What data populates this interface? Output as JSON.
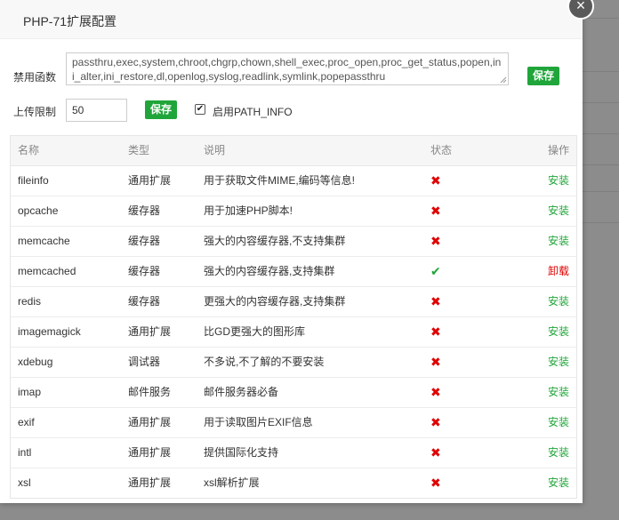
{
  "modal": {
    "title": "PHP-71扩展配置",
    "close": "×"
  },
  "disable_functions": {
    "label": "禁用函数",
    "value": "passthru,exec,system,chroot,chgrp,chown,shell_exec,proc_open,proc_get_status,popen,ini_alter,ini_restore,dl,openlog,syslog,readlink,symlink,popepassthru",
    "save_label": "保存"
  },
  "upload_limit": {
    "label": "上传限制",
    "value": "50",
    "save_label": "保存"
  },
  "path_info": {
    "checked": true,
    "label": "启用PATH_INFO"
  },
  "table": {
    "headers": {
      "name": "名称",
      "type": "类型",
      "desc": "说明",
      "status": "状态",
      "op": "操作"
    },
    "rows": [
      {
        "name": "fileinfo",
        "type": "通用扩展",
        "desc": "用于获取文件MIME,编码等信息!",
        "status": "✖",
        "op": "安装"
      },
      {
        "name": "opcache",
        "type": "缓存器",
        "desc": "用于加速PHP脚本!",
        "status": "✖",
        "op": "安装"
      },
      {
        "name": "memcache",
        "type": "缓存器",
        "desc": "强大的内容缓存器,不支持集群",
        "status": "✖",
        "op": "安装"
      },
      {
        "name": "memcached",
        "type": "缓存器",
        "desc": "强大的内容缓存器,支持集群",
        "status": "✔",
        "op": "卸载"
      },
      {
        "name": "redis",
        "type": "缓存器",
        "desc": "更强大的内容缓存器,支持集群",
        "status": "✖",
        "op": "安装"
      },
      {
        "name": "imagemagick",
        "type": "通用扩展",
        "desc": "比GD更强大的图形库",
        "status": "✖",
        "op": "安装"
      },
      {
        "name": "xdebug",
        "type": "调试器",
        "desc": "不多说,不了解的不要安装",
        "status": "✖",
        "op": "安装"
      },
      {
        "name": "imap",
        "type": "邮件服务",
        "desc": "邮件服务器必备",
        "status": "✖",
        "op": "安装"
      },
      {
        "name": "exif",
        "type": "通用扩展",
        "desc": "用于读取图片EXIF信息",
        "status": "✖",
        "op": "安装"
      },
      {
        "name": "intl",
        "type": "通用扩展",
        "desc": "提供国际化支持",
        "status": "✖",
        "op": "安装"
      },
      {
        "name": "xsl",
        "type": "通用扩展",
        "desc": "xsl解析扩展",
        "status": "✖",
        "op": "安装"
      }
    ]
  }
}
